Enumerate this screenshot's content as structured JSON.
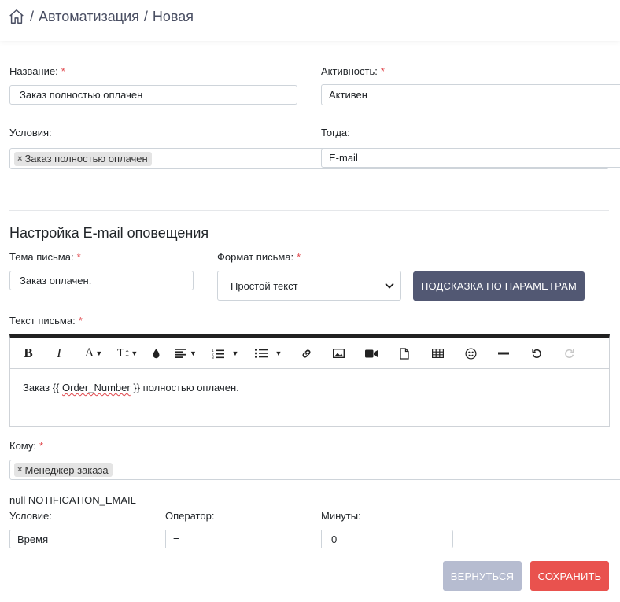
{
  "breadcrumb": {
    "sep": "/",
    "parent": "Автоматизация",
    "current": "Новая"
  },
  "form": {
    "name_label": "Название:",
    "name_value": "Заказ полностью оплачен",
    "activity_label": "Активность:",
    "activity_value": "Активен",
    "conditions_label": "Условия:",
    "conditions_tags": [
      "Заказ полностью оплачен"
    ],
    "then_label": "Тогда:",
    "then_value": "E-mail",
    "required_mark": "*"
  },
  "email_settings": {
    "title": "Настройка E-mail оповещения",
    "subject_label": "Тема письма:",
    "subject_value": "Заказ оплачен.",
    "format_label": "Формат письма:",
    "format_value": "Простой текст",
    "hint_button": "ПОДСКАЗКА ПО ПАРАМЕТРАМ",
    "body_label": "Текст письма:",
    "body_prefix": "Заказ {{ ",
    "body_var": "Order_Number",
    "body_suffix": " }} полностью оплачен."
  },
  "recipients": {
    "label": "Кому:",
    "tags": [
      "Менеджер заказа"
    ]
  },
  "notification": {
    "caption": "null NOTIFICATION_EMAIL",
    "condition_label": "Условие:",
    "operator_label": "Оператор:",
    "minutes_label": "Минуты:",
    "condition_value": "Время",
    "operator_value": "=",
    "minutes_value": "0"
  },
  "actions": {
    "back": "ВЕРНУТЬСЯ",
    "save": "СОХРАНИТЬ"
  },
  "colors": {
    "hint_button": "#525873",
    "back_button": "#b6bcd0",
    "save_button": "#e9524e",
    "required": "#e0474c"
  },
  "toolbar_icons": [
    "bold-icon",
    "italic-icon",
    "font-color-icon",
    "font-size-icon",
    "fill-color-icon",
    "align-icon",
    "ordered-list-icon",
    "unordered-list-icon",
    "link-icon",
    "image-icon",
    "video-icon",
    "file-icon",
    "table-icon",
    "emoji-icon",
    "horizontal-rule-icon",
    "undo-icon",
    "redo-icon"
  ]
}
